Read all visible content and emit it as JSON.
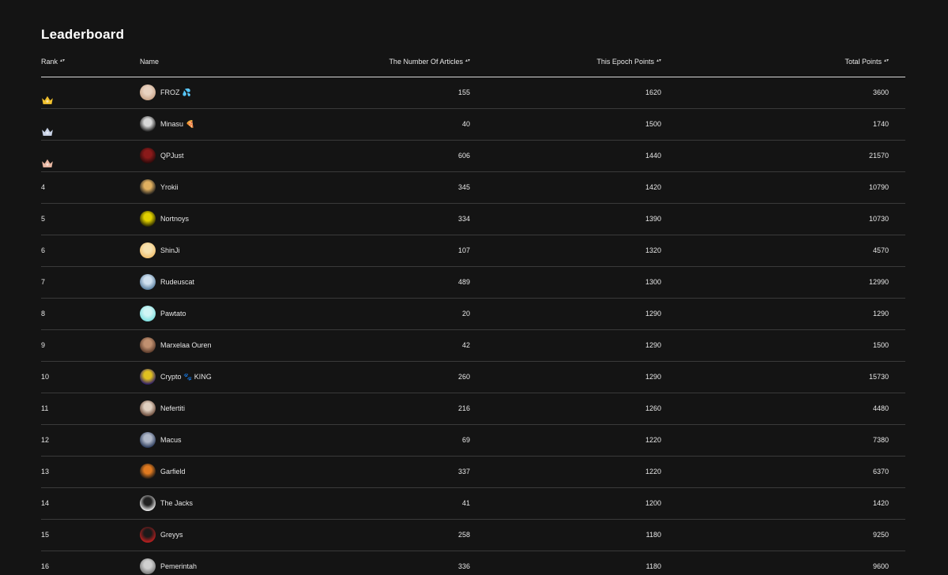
{
  "page": {
    "title": "Leaderboard"
  },
  "columns": {
    "rank": "Rank",
    "name": "Name",
    "articles": "The Number Of Articles",
    "epoch": "This Epoch Points",
    "total": "Total Points",
    "sort_icon": "sort-arrows-icon"
  },
  "colors": {
    "gold": "#f2c230",
    "silver": "#c9d3e6",
    "bronze": "#e8b7a2",
    "background": "#141414"
  },
  "rows": [
    {
      "rank": "1",
      "medal": "gold",
      "name": "FROZ",
      "suffix": "💦",
      "articles": "155",
      "epoch": "1620",
      "total": "3600",
      "avatar": [
        "#c9a58a",
        "#e8d2c0"
      ]
    },
    {
      "rank": "2",
      "medal": "silver",
      "name": "Minasu",
      "suffix": "🍕",
      "articles": "40",
      "epoch": "1500",
      "total": "1740",
      "avatar": [
        "#1b1b1b",
        "#d9d9d9"
      ]
    },
    {
      "rank": "3",
      "medal": "bronze",
      "name": "QPJust",
      "suffix": "",
      "articles": "606",
      "epoch": "1440",
      "total": "21570",
      "avatar": [
        "#2a0a0a",
        "#8a1a1a"
      ]
    },
    {
      "rank": "4",
      "medal": "",
      "name": "Yrokii",
      "suffix": "",
      "articles": "345",
      "epoch": "1420",
      "total": "10790",
      "avatar": [
        "#1a1a1a",
        "#e0b060"
      ]
    },
    {
      "rank": "5",
      "medal": "",
      "name": "Nortnoys",
      "suffix": "",
      "articles": "334",
      "epoch": "1390",
      "total": "10730",
      "avatar": [
        "#2b2a00",
        "#e0d000"
      ]
    },
    {
      "rank": "6",
      "medal": "",
      "name": "ShinJi",
      "suffix": "",
      "articles": "107",
      "epoch": "1320",
      "total": "4570",
      "avatar": [
        "#f0c070",
        "#f7e2b0"
      ]
    },
    {
      "rank": "7",
      "medal": "",
      "name": "Rudeuscat",
      "suffix": "",
      "articles": "489",
      "epoch": "1300",
      "total": "12990",
      "avatar": [
        "#5a7fa0",
        "#cfe0ef"
      ]
    },
    {
      "rank": "8",
      "medal": "",
      "name": "Pawtato",
      "suffix": "",
      "articles": "20",
      "epoch": "1290",
      "total": "1290",
      "avatar": [
        "#7fe0e0",
        "#d0f5f5"
      ]
    },
    {
      "rank": "9",
      "medal": "",
      "name": "Marxelaa Ouren",
      "suffix": "",
      "articles": "42",
      "epoch": "1290",
      "total": "1500",
      "avatar": [
        "#5a3a2a",
        "#c09070"
      ]
    },
    {
      "rank": "10",
      "medal": "",
      "name": "Crypto 🐾 KING",
      "suffix": "",
      "articles": "260",
      "epoch": "1290",
      "total": "15730",
      "avatar": [
        "#2a1a6a",
        "#e0c020"
      ]
    },
    {
      "rank": "11",
      "medal": "",
      "name": "Nefertiti",
      "suffix": "",
      "articles": "216",
      "epoch": "1260",
      "total": "4480",
      "avatar": [
        "#6a4a3a",
        "#e0d0c0"
      ]
    },
    {
      "rank": "12",
      "medal": "",
      "name": "Macus",
      "suffix": "",
      "articles": "69",
      "epoch": "1220",
      "total": "7380",
      "avatar": [
        "#2a3a5a",
        "#b0b8c8"
      ]
    },
    {
      "rank": "13",
      "medal": "",
      "name": "Garfield",
      "suffix": "",
      "articles": "337",
      "epoch": "1220",
      "total": "6370",
      "avatar": [
        "#141414",
        "#e07a20"
      ]
    },
    {
      "rank": "14",
      "medal": "",
      "name": "The Jacks",
      "suffix": "",
      "articles": "41",
      "epoch": "1200",
      "total": "1420",
      "avatar": [
        "#f0f0f0",
        "#222222"
      ]
    },
    {
      "rank": "15",
      "medal": "",
      "name": "Greyys",
      "suffix": "",
      "articles": "258",
      "epoch": "1180",
      "total": "9250",
      "avatar": [
        "#c02020",
        "#1a1a1a"
      ]
    },
    {
      "rank": "16",
      "medal": "",
      "name": "Pemerintah",
      "suffix": "",
      "articles": "336",
      "epoch": "1180",
      "total": "9600",
      "avatar": [
        "#7a7a7a",
        "#d0d0d0"
      ]
    }
  ]
}
